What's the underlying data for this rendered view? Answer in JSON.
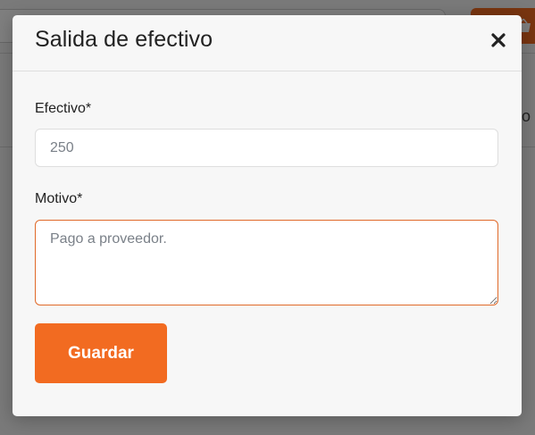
{
  "modal": {
    "title": "Salida de efectivo",
    "close_icon": "close-icon",
    "fields": {
      "efectivo": {
        "label": "Efectivo*",
        "value": "",
        "placeholder": "250"
      },
      "motivo": {
        "label": "Motivo*",
        "value": "",
        "placeholder": "Pago a proveedor."
      }
    },
    "save_label": "Guardar"
  },
  "background": {
    "partial_text": "o",
    "button_icon": "basket-icon"
  },
  "colors": {
    "accent": "#f26b21",
    "motivo_border": "#e06a2a",
    "backdrop": "rgba(0,0,0,0.5)"
  }
}
